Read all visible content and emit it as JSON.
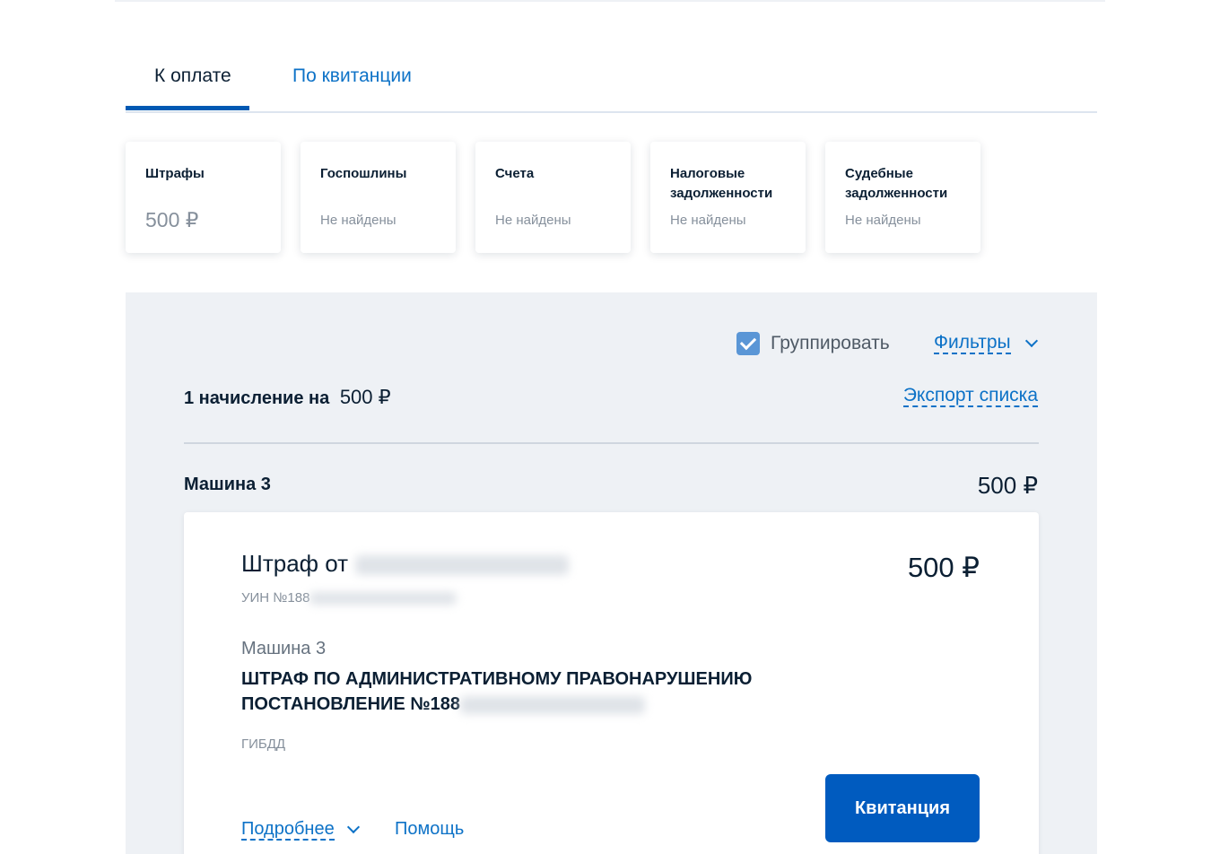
{
  "tabs": [
    {
      "label": "К оплате",
      "active": true
    },
    {
      "label": "По квитанции",
      "active": false
    }
  ],
  "categories": [
    {
      "title": "Штрафы",
      "value": "500 ₽",
      "has_amount": true
    },
    {
      "title": "Госпошлины",
      "value": "Не найдены",
      "has_amount": false
    },
    {
      "title": "Счета",
      "value": "Не найдены",
      "has_amount": false
    },
    {
      "title": "Налоговые задолженности",
      "value": "Не найдены",
      "has_amount": false
    },
    {
      "title": "Судебные задолженности",
      "value": "Не найдены",
      "has_amount": false
    }
  ],
  "controls": {
    "group_label": "Группировать",
    "group_checked": true,
    "filters_label": "Фильтры",
    "export_label": "Экспорт списка"
  },
  "summary": {
    "count_text": "1 начисление на",
    "amount": "500 ₽"
  },
  "group": {
    "name": "Машина 3",
    "amount": "500 ₽"
  },
  "fine": {
    "title_prefix": "Штраф от",
    "amount": "500 ₽",
    "uin_prefix": "УИН №188",
    "vehicle": "Машина 3",
    "description_line1": "ШТРАФ ПО АДМИНИСТРАТИВНОМУ ПРАВОНАРУШЕНИЮ",
    "description_line2_prefix": "ПОСТАНОВЛЕНИЕ №188",
    "agency": "ГИБДД",
    "details_label": "Подробнее",
    "help_label": "Помощь",
    "receipt_button": "Квитанция"
  },
  "colors": {
    "accent": "#0059b3",
    "link": "#0d72c7",
    "panel_bg": "#eef1f5",
    "muted_text": "#86909c"
  }
}
